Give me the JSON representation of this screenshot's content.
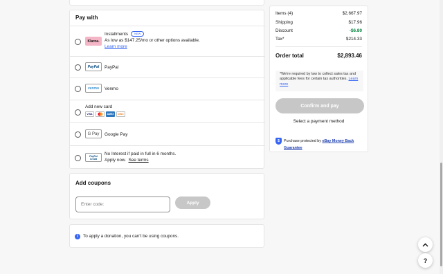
{
  "pay_with": {
    "title": "Pay with",
    "options": [
      {
        "logo": "Klarna.",
        "label": "Installments",
        "badge": "NEW",
        "line2": "As low as $147.25/mo or other options available.",
        "link": "Learn more"
      },
      {
        "logo": "PayPal",
        "label": "PayPal"
      },
      {
        "logo": "venmo",
        "label": "Venmo"
      },
      {
        "label": "Add new card",
        "cards": [
          "VISA",
          "MC",
          "AMEX",
          "DISC"
        ]
      },
      {
        "logo": "G Pay",
        "label": "Google Pay"
      },
      {
        "logo": "PayPal Credit",
        "label": "No Interest if paid in full in 6 months.",
        "line2": "Apply now.",
        "link": "See terms"
      }
    ]
  },
  "coupons": {
    "title": "Add coupons",
    "placeholder": "Enter code:",
    "apply_label": "Apply"
  },
  "donation": {
    "text": "To apply a donation, you can't be using coupons."
  },
  "summary": {
    "items_label": "Items (4)",
    "items_value": "$2,667.97",
    "shipping_label": "Shipping",
    "shipping_value": "$17.96",
    "discount_label": "Discount",
    "discount_value": "-$6.80",
    "tax_label": "Tax*",
    "tax_value": "$214.33",
    "total_label": "Order total",
    "total_value": "$2,893.46",
    "notice": "*We're required by law to collect sales tax and applicable fees for certain tax authorities.",
    "notice_link": "Learn more",
    "confirm_label": "Confirm and pay",
    "select_hint": "Select a payment method",
    "protect_text": "Purchase protected by",
    "protect_link": "eBay Money Back Guarantee"
  },
  "colors": {
    "accent": "#3665f3",
    "discount": "#05823f",
    "disabled": "#c7c7c7"
  }
}
